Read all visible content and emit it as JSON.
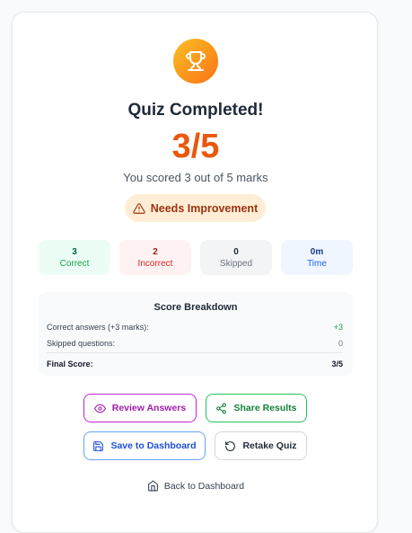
{
  "header": {
    "trophy_icon": "trophy-icon",
    "title": "Quiz Completed!",
    "score": "3/5",
    "subtitle": "You scored 3 out of 5 marks",
    "badge": {
      "icon": "warning-icon",
      "label": "Needs Improvement"
    }
  },
  "stats": [
    {
      "value": "3",
      "label": "Correct"
    },
    {
      "value": "2",
      "label": "Incorrect"
    },
    {
      "value": "0",
      "label": "Skipped"
    },
    {
      "value": "0m",
      "label": "Time"
    }
  ],
  "breakdown": {
    "title": "Score Breakdown",
    "rows": [
      {
        "label": "Correct answers (+3 marks):",
        "value": "+3"
      },
      {
        "label": "Skipped questions:",
        "value": "0"
      }
    ],
    "final": {
      "label": "Final Score:",
      "value": "3/5"
    }
  },
  "actions": {
    "review": {
      "label": "Review Answers",
      "icon": "eye-icon"
    },
    "share": {
      "label": "Share Results",
      "icon": "share-icon"
    },
    "save": {
      "label": "Save to Dashboard",
      "icon": "save-icon"
    },
    "retake": {
      "label": "Retake Quiz",
      "icon": "rotate-ccw-icon"
    }
  },
  "back": {
    "label": "Back to Dashboard",
    "icon": "home-icon"
  },
  "colors": {
    "accent": "#ea580c",
    "trophy_start": "#fbbf24",
    "trophy_end": "#f97316",
    "correct": "#16a34a",
    "incorrect": "#dc2626",
    "time": "#2563eb",
    "review": "#a21caf",
    "share": "#15803d",
    "save": "#1d4ed8"
  }
}
